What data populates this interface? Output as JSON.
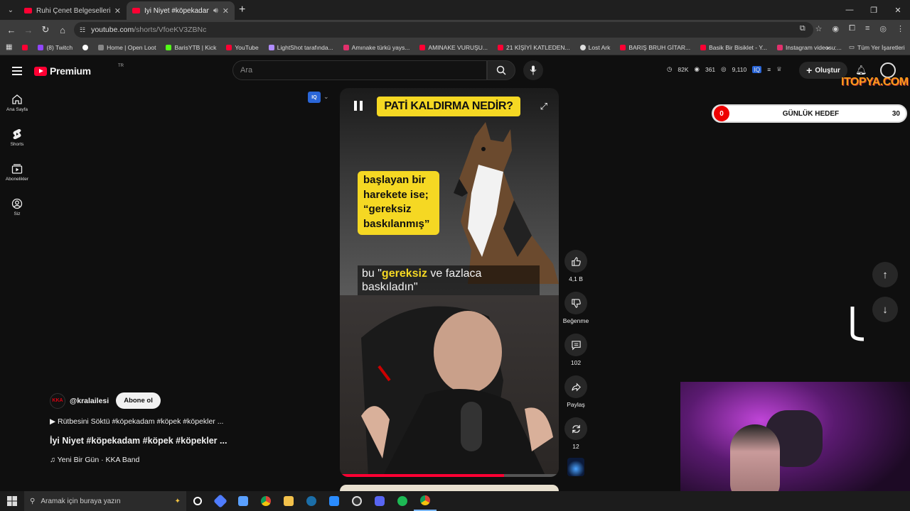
{
  "browser": {
    "tabs": [
      {
        "title": "Ruhi Çenet Belgeselleri - YouTu",
        "active": false
      },
      {
        "title": "İyi Niyet #köpekadam #köp",
        "active": true
      }
    ],
    "url_host": "youtube.com",
    "url_path": "/shorts/VfoeKV3ZBNc",
    "bookmarks": [
      {
        "label": "",
        "color": "#ff0033"
      },
      {
        "label": "(8) Twitch",
        "color": "#9146ff"
      },
      {
        "label": "",
        "color": "#ffffff"
      },
      {
        "label": "Home | Open Loot",
        "color": "#888888"
      },
      {
        "label": "BarisYTB | Kick",
        "color": "#53fc18"
      },
      {
        "label": "YouTube",
        "color": "#ff0033"
      },
      {
        "label": "LightShot tarafında...",
        "color": "#b08cff"
      },
      {
        "label": "Amınake türkü yays...",
        "color": "#e1306c"
      },
      {
        "label": "AMINAKE VURUŞU...",
        "color": "#ff0033"
      },
      {
        "label": "21 KİŞİYİ KATLEDEN...",
        "color": "#ff0033"
      },
      {
        "label": "Lost Ark",
        "color": "#dddddd"
      },
      {
        "label": "BARIŞ BRUH GİTAR...",
        "color": "#ff0033"
      },
      {
        "label": "Basik Bir Bisiklet - Y...",
        "color": "#ff0033"
      },
      {
        "label": "Instagram videosu:...",
        "color": "#e1306c"
      }
    ],
    "bookmarks_all": "Tüm Yer İşaretleri"
  },
  "header": {
    "logo": "Premium",
    "logo_sup": "TR",
    "search_placeholder": "Ara",
    "stats": [
      "82K",
      "361",
      "9,110"
    ],
    "create_label": "Oluştur",
    "watermark": "ITOPYA.COM"
  },
  "sidebar": [
    {
      "label": "Ana Sayfa",
      "icon": "home-icon"
    },
    {
      "label": "Shorts",
      "icon": "shorts-icon"
    },
    {
      "label": "Abonelikler",
      "icon": "subscriptions-icon"
    },
    {
      "label": "Siz",
      "icon": "account-icon"
    }
  ],
  "goal": {
    "current": "0",
    "label": "GÜNLÜK HEDEF",
    "target": "30"
  },
  "overlay": {
    "iq": "IQ"
  },
  "video": {
    "top_title": "PATİ KALDIRMA NEDİR?",
    "yellow_text": [
      "başlayan bir",
      "harekete ise;",
      "“gereksiz",
      "baskılanmış”"
    ],
    "subtitle_pre": "bu \"",
    "subtitle_bold": "gereksiz",
    "subtitle_post": " ve fazlaca baskıladın\"",
    "progress": 0.75
  },
  "actions": [
    {
      "label": "4,1 B",
      "icon": "like-icon"
    },
    {
      "label": "Beğenme",
      "icon": "dislike-icon"
    },
    {
      "label": "102",
      "icon": "comment-icon"
    },
    {
      "label": "Paylaş",
      "icon": "share-icon"
    },
    {
      "label": "12",
      "icon": "remix-icon"
    }
  ],
  "channel": {
    "avatar": "KKA",
    "handle": "@kralailesi",
    "subscribe": "Abone ol",
    "description": "▶ Rütbesini Söktü #köpekadam #köpek #köpekler ...",
    "title": "İyi Niyet #köpekadam #köpek #köpekler ...",
    "music": "♫ Yeni Bir Gün · KKA Band"
  },
  "taskbar": {
    "search_placeholder": "Aramak için buraya yazın",
    "apps": [
      {
        "name": "cortana",
        "color": "#ffffff"
      },
      {
        "name": "app-blue",
        "color": "#4f7cff"
      },
      {
        "name": "store",
        "color": "#5aa0ff"
      },
      {
        "name": "chrome",
        "color": "#f4c20d"
      },
      {
        "name": "explorer",
        "color": "#f3c14b"
      },
      {
        "name": "steam",
        "color": "#1b6ea8"
      },
      {
        "name": "app-blue2",
        "color": "#2a8cff"
      },
      {
        "name": "obs",
        "color": "#dddddd"
      },
      {
        "name": "discord",
        "color": "#5865f2"
      },
      {
        "name": "spotify",
        "color": "#1db954"
      },
      {
        "name": "chrome-active",
        "color": "#f4c20d"
      }
    ]
  }
}
